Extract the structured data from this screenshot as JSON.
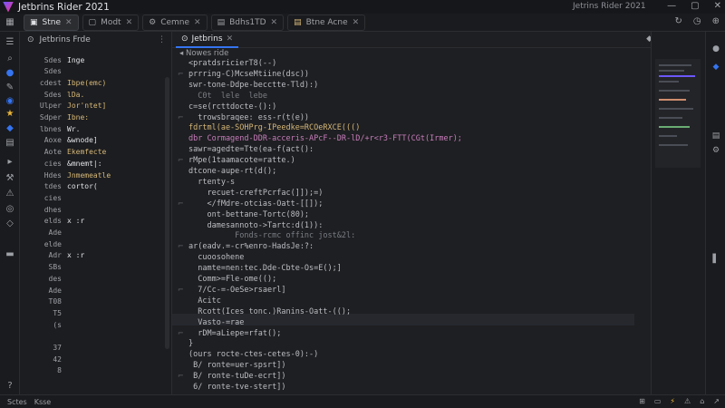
{
  "window": {
    "title": "Jetbrins Rider 2021",
    "center_title": "Jetrins Rider 2021",
    "controls": [
      "—",
      "▢",
      "✕"
    ]
  },
  "tabs": [
    {
      "label": "Stne",
      "icon": "folder-icon",
      "active": true
    },
    {
      "label": "Modt",
      "icon": "file-icon",
      "active": false
    },
    {
      "label": "Cemne",
      "icon": "gear-icon",
      "active": false
    },
    {
      "label": "Bdhs1TD",
      "icon": "file-icon",
      "active": false
    },
    {
      "label": "Btne Acne",
      "icon": "file-icon",
      "active": false
    }
  ],
  "project_panel": {
    "title": "Jetbrins Frde",
    "rows": [
      {
        "k": "Sdes",
        "v": "Inge",
        "style": "white"
      },
      {
        "k": "Sdes",
        "v": "",
        "style": ""
      },
      {
        "k": "cdest",
        "v": "Ibpe(emc)",
        "style": "hl"
      },
      {
        "k": "Sdes",
        "v": "lDa.",
        "style": "hl"
      },
      {
        "k": "Ulper",
        "v": "Jor'ntet]",
        "style": "hl"
      },
      {
        "k": "Sdper",
        "v": "Ibne:",
        "style": "hl"
      },
      {
        "k": "lbnes",
        "v": "Wr.",
        "style": "white"
      },
      {
        "k": "Aoxe",
        "v": "&wnode]",
        "style": "white"
      },
      {
        "k": "Aote",
        "v": "Ekemfecte",
        "style": "hl"
      },
      {
        "k": "cies",
        "v": "&mnemt|:",
        "style": "white"
      },
      {
        "k": "Hdes",
        "v": "Jnmemeatle",
        "style": "hl"
      },
      {
        "k": "tdes",
        "v": "cortor(",
        "style": "white"
      },
      {
        "k": "cies",
        "v": "",
        "style": ""
      },
      {
        "k": "dhes",
        "v": "",
        "style": ""
      },
      {
        "k": "elds",
        "v": "x :r",
        "style": "white"
      },
      {
        "k": "Ade",
        "v": "",
        "style": ""
      },
      {
        "k": "elde",
        "v": "",
        "style": ""
      },
      {
        "k": "Adr",
        "v": "x :r",
        "style": "white"
      },
      {
        "k": "SBs",
        "v": "",
        "style": ""
      },
      {
        "k": "des",
        "v": "",
        "style": ""
      },
      {
        "k": "Ade",
        "v": "",
        "style": ""
      },
      {
        "k": "T08",
        "v": "",
        "style": ""
      },
      {
        "k": "T5",
        "v": "",
        "style": ""
      },
      {
        "k": "(s",
        "v": "",
        "style": ""
      },
      {
        "k": "",
        "v": "",
        "style": ""
      },
      {
        "k": "37",
        "v": "",
        "style": ""
      },
      {
        "k": "42",
        "v": "",
        "style": ""
      },
      {
        "k": "8",
        "v": "",
        "style": ""
      }
    ]
  },
  "editor": {
    "tab": "Jetbrins",
    "breadcrumb": "Nowes ride",
    "tools": [
      "◆",
      "◀",
      "⌕",
      "●",
      "⚙"
    ]
  },
  "code": [
    {
      "text": "<pratdsricierT8(--)",
      "cls": ""
    },
    {
      "text": "prrring-C)McseMtiine(dsc))",
      "cls": ""
    },
    {
      "text": "swr-tone-Ddpe-becctte-Tld):)",
      "cls": ""
    },
    {
      "text": "  C0t  lele  lebe",
      "cls": "dim"
    },
    {
      "text": "c=se(rcttdocte-():)",
      "cls": ""
    },
    {
      "text": "  trowsbraqee: ess-r(t(e))",
      "cls": ""
    },
    {
      "text": "fdrtml(ae-SOHPrg-IPeedke=RCOeRXCE((()",
      "cls": "mix"
    },
    {
      "text": "dbr Cormagend-DDR-acceris-APcF--DR-lD/+r<r3-FTT(CGt(Irmer);",
      "cls": "mix2"
    },
    {
      "text": "sawr=agedte=Tte(ea-f(act():",
      "cls": ""
    },
    {
      "text": "rMpe(1taamacote=ratte.)",
      "cls": ""
    },
    {
      "text": "dtcone-aupe-rt(d();",
      "cls": ""
    },
    {
      "text": "  rtenty-s",
      "cls": ""
    },
    {
      "text": "    recuet-creftPcrfac(]]);=)",
      "cls": ""
    },
    {
      "text": "    </fMdre-otcias-Oatt-[[]);",
      "cls": ""
    },
    {
      "text": "    ont-bettane-Tortc(80);",
      "cls": ""
    },
    {
      "text": "    damesannoto->Tartc:d(1)):",
      "cls": ""
    },
    {
      "text": "          Fonds-rcmc offinc jost&2l:",
      "cls": "dim"
    },
    {
      "text": "ar(eadv.=-cr%enro-HadsJe:?:",
      "cls": ""
    },
    {
      "text": "  cuoosohene",
      "cls": ""
    },
    {
      "text": "  namte=nen:tec.Dde-Cbte-Os=E();]",
      "cls": ""
    },
    {
      "text": "  Comm>=Fle-ome(();",
      "cls": ""
    },
    {
      "text": "  7/Cc-=-OeSe>rsaerl]",
      "cls": ""
    },
    {
      "text": "  Acitc",
      "cls": ""
    },
    {
      "text": "  Rcott(Ices tonc.)Ranins-Oatt-(();",
      "cls": ""
    },
    {
      "text": "  Vasto-=rae",
      "cls": ""
    },
    {
      "text": "  rDM=aLiepe=rfat();",
      "cls": ""
    },
    {
      "text": "}",
      "cls": ""
    },
    {
      "text": "(ours rocte-ctes-cetes-0):-)",
      "cls": ""
    },
    {
      "text": " B/ ronte=uer-spsrt])",
      "cls": ""
    },
    {
      "text": " B/ ronte-tuDe-ecrt])",
      "cls": ""
    },
    {
      "text": " 6/ ronte-tve-stert])",
      "cls": ""
    }
  ],
  "status": {
    "left": [
      "Sctes",
      "Ksse"
    ],
    "right": [
      "⊞",
      "▭",
      "⚡",
      "⚠",
      "⌂",
      "↗"
    ]
  }
}
